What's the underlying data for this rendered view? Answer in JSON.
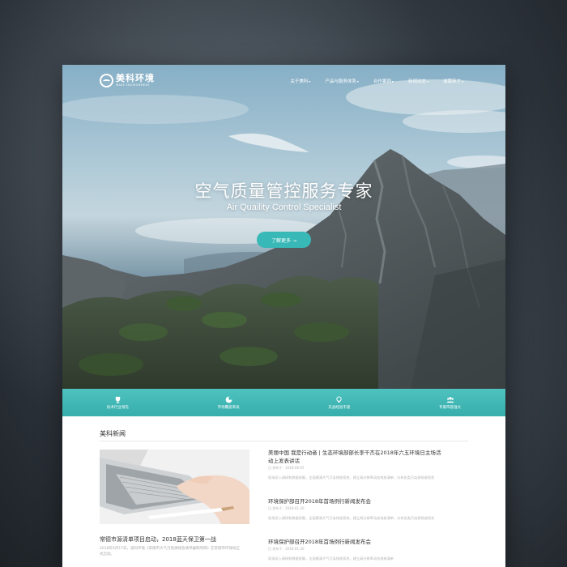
{
  "nav": {
    "logo_text": "美科环境",
    "logo_subtext": "MAKE ENVIRONMENT",
    "menu": [
      {
        "label": "关于美科"
      },
      {
        "label": "产品与服务体系"
      },
      {
        "label": "合作案例"
      },
      {
        "label": "新闻动态"
      },
      {
        "label": "诚聘英才"
      }
    ]
  },
  "hero": {
    "title": "空气质量管控服务专家",
    "subtitle": "Air Quaility Control Specialist",
    "cta_label": "了解更多 →"
  },
  "features": [
    {
      "label": "技术行业领先",
      "icon": "trophy-icon"
    },
    {
      "label": "市场覆盖率高",
      "icon": "pie-chart-icon"
    },
    {
      "label": "实战经验丰富",
      "icon": "lightbulb-icon"
    },
    {
      "label": "专家阵容强大",
      "icon": "team-icon"
    }
  ],
  "news": {
    "section_title": "美科新闻",
    "featured": {
      "title": "常德市源清单项目启动，2018蓝天保卫第一战",
      "excerpt": "2018年4月17日，美科环境《常德市大气污染源排放清单编制项目》在常德市环保局正式启动。"
    },
    "items": [
      {
        "title": "美丽中国 我是行动者 | 生态环境部部长李干杰在2018年六五环境日主场活动上发表讲话",
        "date": "日 发布于：2018-06-05",
        "excerpt": "现场深入调研和数据采集，全面摸清大气污染排放家底，建立高分辨率动态排放清单，分析各类污染源排放现状"
      },
      {
        "title": "环境保护部召开2018年首场例行新闻发布会",
        "date": "日 发布于：2018-01-30",
        "excerpt": "现场深入调研和数据采集，全面摸清大气污染排放家底，建立高分辨率动态排放清单，分析各类污染源排放现状"
      },
      {
        "title": "环境保护部召开2018年首场例行新闻发布会",
        "date": "日 发布于：2018-01-30",
        "excerpt": "现场深入调研和数据采集，全面摸清大气污染排放家底，建立高分辨率动态排放清单"
      }
    ]
  },
  "colors": {
    "accent": "#38b8b6",
    "backdrop": "#343c44"
  }
}
